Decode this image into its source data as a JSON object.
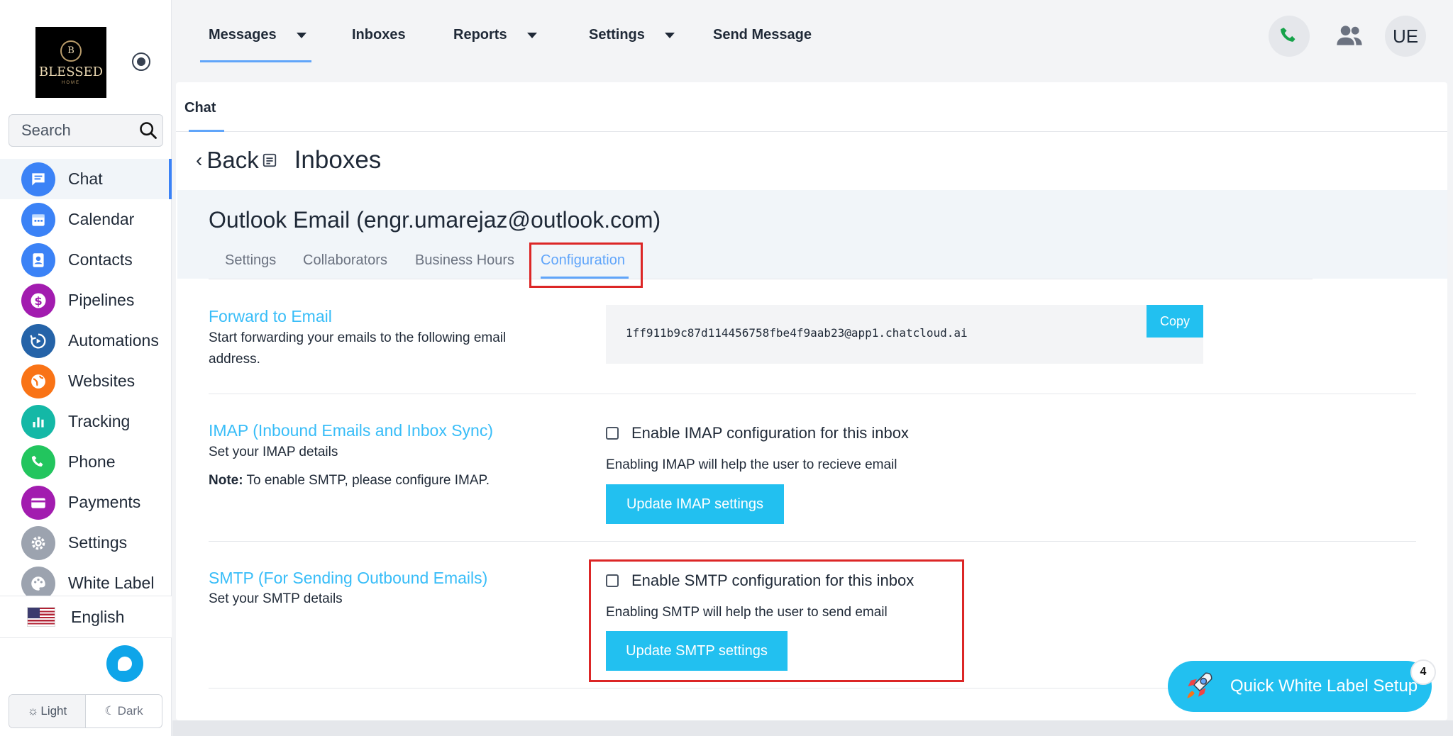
{
  "brand": {
    "logo_text": "BLESSED",
    "logo_letter": "B",
    "logo_sub": "HOME"
  },
  "sidebar": {
    "search_placeholder": "Search",
    "items": [
      {
        "label": "Chat",
        "icon": "chat-icon",
        "color": "#3b82f6"
      },
      {
        "label": "Calendar",
        "icon": "calendar-icon",
        "color": "#3b82f6"
      },
      {
        "label": "Contacts",
        "icon": "contacts-icon",
        "color": "#3b82f6"
      },
      {
        "label": "Pipelines",
        "icon": "dollar-icon",
        "color": "#a21caf"
      },
      {
        "label": "Automations",
        "icon": "automation-icon",
        "color": "#2563a8"
      },
      {
        "label": "Websites",
        "icon": "globe-icon",
        "color": "#f97316"
      },
      {
        "label": "Tracking",
        "icon": "chart-icon",
        "color": "#14b8a6"
      },
      {
        "label": "Phone",
        "icon": "phone-icon",
        "color": "#22c55e"
      },
      {
        "label": "Payments",
        "icon": "card-icon",
        "color": "#a21caf"
      },
      {
        "label": "Settings",
        "icon": "gear-icon",
        "color": "#9ca3af"
      },
      {
        "label": "White Label",
        "icon": "palette-icon",
        "color": "#9ca3af"
      }
    ],
    "language": "English",
    "theme": {
      "light": "Light",
      "dark": "Dark"
    }
  },
  "topnav": {
    "items": [
      {
        "label": "Messages",
        "dropdown": true
      },
      {
        "label": "Inboxes",
        "dropdown": false
      },
      {
        "label": "Reports",
        "dropdown": true
      },
      {
        "label": "Settings",
        "dropdown": true
      },
      {
        "label": "Send Message",
        "dropdown": false
      }
    ],
    "avatar": "UE"
  },
  "content": {
    "tab": "Chat",
    "back": "Back",
    "title": "Inboxes",
    "inbox_name": "Outlook Email (engr.umarejaz@outlook.com)",
    "tabs": [
      "Settings",
      "Collaborators",
      "Business Hours",
      "Configuration"
    ],
    "active_tab": "Configuration",
    "forward": {
      "title": "Forward to Email",
      "desc_line1": "Start forwarding your emails to the following email",
      "desc_line2": "address.",
      "address": "1ff911b9c87d114456758fbe4f9aab23@app1.chatcloud.ai",
      "copy": "Copy"
    },
    "imap": {
      "title": "IMAP (Inbound Emails and Inbox Sync)",
      "desc": "Set your IMAP details",
      "note_label": "Note:",
      "note": " To enable SMTP, please configure IMAP.",
      "checkbox": "Enable IMAP configuration for this inbox",
      "help": "Enabling IMAP will help the user to recieve email",
      "button": "Update IMAP settings"
    },
    "smtp": {
      "title": "SMTP (For Sending Outbound Emails)",
      "desc": "Set your SMTP details",
      "checkbox": "Enable SMTP configuration for this inbox",
      "help": "Enabling SMTP will help the user to send email",
      "button": "Update SMTP settings"
    }
  },
  "quick_setup": {
    "label": "Quick White Label Setup",
    "badge": "4"
  },
  "colors": {
    "accent": "#22c0f0",
    "link": "#38bdf8",
    "highlight": "#dc2626"
  }
}
